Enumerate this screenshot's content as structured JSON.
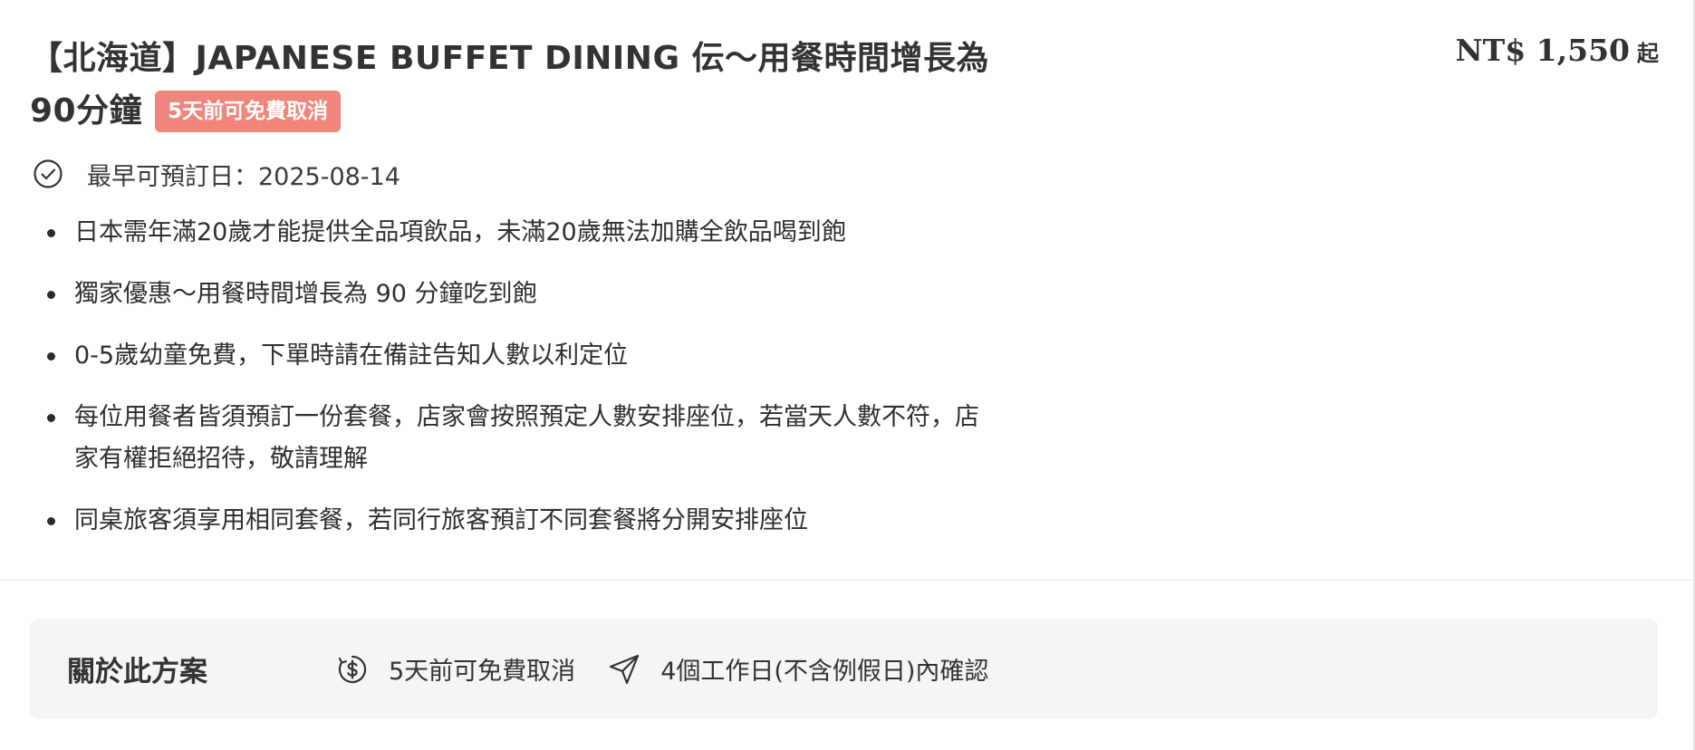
{
  "product": {
    "title": "【北海道】JAPANESE BUFFET DINING 伝～用餐時間增長為90分鐘",
    "cancel_badge": "5天前可免費取消",
    "price": "NT$ 1,550",
    "price_suffix": "起",
    "earliest_date": "最早可預訂日：2025-08-14",
    "notes": [
      "日本需年滿20歲才能提供全品項飲品，未滿20歲無法加購全飲品喝到飽",
      "獨家優惠～用餐時間增長為 90 分鐘吃到飽",
      "0-5歲幼童免費，下單時請在備註告知人數以利定位",
      "每位用餐者皆須預訂一份套餐，店家會按照預定人數安排座位，若當天人數不符，店家有權拒絕招待，敬請理解",
      "同桌旅客須享用相同套餐，若同行旅客預訂不同套餐將分開安排座位"
    ]
  },
  "about": {
    "title": "關於此方案",
    "items": [
      {
        "icon": "dollar-refund-icon",
        "text": "5天前可免費取消"
      },
      {
        "icon": "paper-plane-icon",
        "text": "4個工作日(不含例假日)內確認"
      }
    ]
  },
  "colors": {
    "badge_bg": "#f0857c",
    "panel_bg": "#f5f5f5",
    "text": "#333333"
  }
}
